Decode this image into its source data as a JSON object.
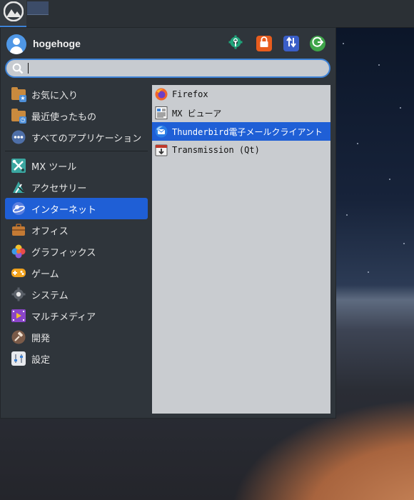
{
  "panel": {
    "logo_icon": "mx-logo-icon"
  },
  "user": {
    "name": "hogehoge",
    "avatar_icon": "user-avatar-icon"
  },
  "actions": [
    {
      "name": "settings",
      "icon": "settings-gear-icon",
      "color": "#1fa37a"
    },
    {
      "name": "lock",
      "icon": "lock-icon",
      "color": "#e85d1e"
    },
    {
      "name": "switch-user",
      "icon": "switch-user-icon",
      "color": "#3a5ec7"
    },
    {
      "name": "logout",
      "icon": "logout-icon",
      "color": "#3fa54a"
    }
  ],
  "search": {
    "value": "",
    "placeholder": ""
  },
  "categories_top": [
    {
      "label": "お気に入り",
      "icon": "favorites-folder-icon"
    },
    {
      "label": "最近使ったもの",
      "icon": "recent-folder-icon"
    },
    {
      "label": "すべてのアプリケーション",
      "icon": "all-apps-icon"
    }
  ],
  "categories": [
    {
      "label": "MX ツール",
      "icon": "mx-tools-icon"
    },
    {
      "label": "アクセサリー",
      "icon": "accessories-icon"
    },
    {
      "label": "インターネット",
      "icon": "internet-icon",
      "selected": true
    },
    {
      "label": "オフィス",
      "icon": "office-icon"
    },
    {
      "label": "グラフィックス",
      "icon": "graphics-icon"
    },
    {
      "label": "ゲーム",
      "icon": "games-icon"
    },
    {
      "label": "システム",
      "icon": "system-icon"
    },
    {
      "label": "マルチメディア",
      "icon": "multimedia-icon"
    },
    {
      "label": "開発",
      "icon": "development-icon"
    },
    {
      "label": "設定",
      "icon": "settings-icon"
    }
  ],
  "apps": [
    {
      "label": "Firefox",
      "icon": "firefox-icon"
    },
    {
      "label": "MX ビューア",
      "icon": "mx-viewer-icon"
    },
    {
      "label": "Thunderbird電子メールクライアント",
      "icon": "thunderbird-icon",
      "selected": true
    },
    {
      "label": "Transmission (Qt)",
      "icon": "transmission-icon"
    }
  ],
  "colors": {
    "accent": "#1f5fd6",
    "menu_bg": "#2f353b",
    "apps_bg": "#c9ccd0"
  }
}
